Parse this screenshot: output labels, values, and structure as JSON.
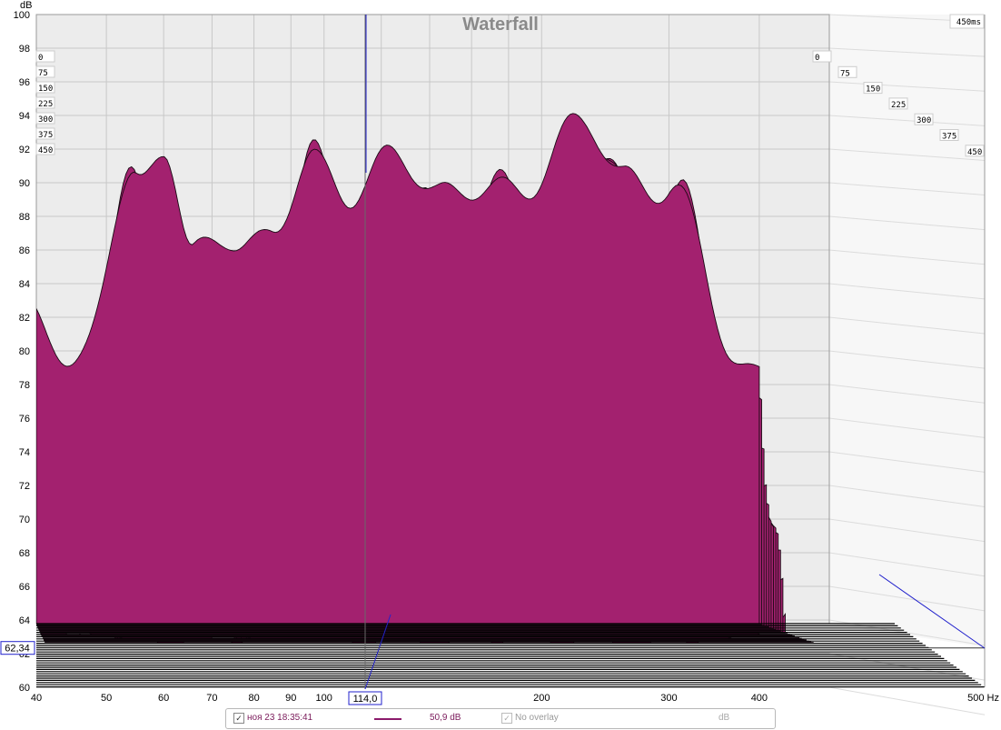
{
  "chart_data": {
    "type": "waterfall",
    "title": "Waterfall",
    "y_unit": "dB",
    "x_unit": "Hz",
    "ylim": [
      60,
      100
    ],
    "xlim": [
      40,
      500
    ],
    "x_scale": "log",
    "y_ticks": [
      "100",
      "98",
      "96",
      "94",
      "92",
      "90",
      "88",
      "86",
      "84",
      "82",
      "80",
      "78",
      "76",
      "74",
      "72",
      "70",
      "68",
      "66",
      "64",
      "62",
      "60"
    ],
    "x_ticks": [
      "40",
      "50",
      "60",
      "70",
      "80",
      "90",
      "100",
      "200",
      "300",
      "400",
      "500 Hz"
    ],
    "x_tick_values": [
      40,
      50,
      60,
      70,
      80,
      90,
      100,
      200,
      300,
      400,
      500
    ],
    "time_labels": [
      "0",
      "75",
      "150",
      "225",
      "300",
      "375",
      "450"
    ],
    "time_end_label": "450ms",
    "cursor_freq_label": "114,0",
    "cursor_freq": 114,
    "cursor_level_label": "62,34",
    "cursor_level": 62.34,
    "first_slice_peaks": [
      {
        "f": 40,
        "db": 83
      },
      {
        "f": 45,
        "db": 79
      },
      {
        "f": 55,
        "db": 90
      },
      {
        "f": 60,
        "db": 93
      },
      {
        "f": 66,
        "db": 85
      },
      {
        "f": 75,
        "db": 87
      },
      {
        "f": 85,
        "db": 87
      },
      {
        "f": 97,
        "db": 91
      },
      {
        "f": 110,
        "db": 90
      },
      {
        "f": 128,
        "db": 91
      },
      {
        "f": 145,
        "db": 90
      },
      {
        "f": 170,
        "db": 89
      },
      {
        "f": 230,
        "db": 93
      },
      {
        "f": 260,
        "db": 91
      },
      {
        "f": 300,
        "db": 89
      },
      {
        "f": 400,
        "db": 78
      }
    ],
    "colors": {
      "fill": "#a3216f",
      "line": "#1a0a14",
      "cursor": "#2222cc",
      "grid": "#c8c8c8"
    }
  },
  "legend": {
    "checkbox_mark": "✓",
    "measurement_label": "ноя 23 18:35:41",
    "value": "50,9 dB",
    "overlay_label": "No overlay",
    "overlay_unit": "dB"
  }
}
